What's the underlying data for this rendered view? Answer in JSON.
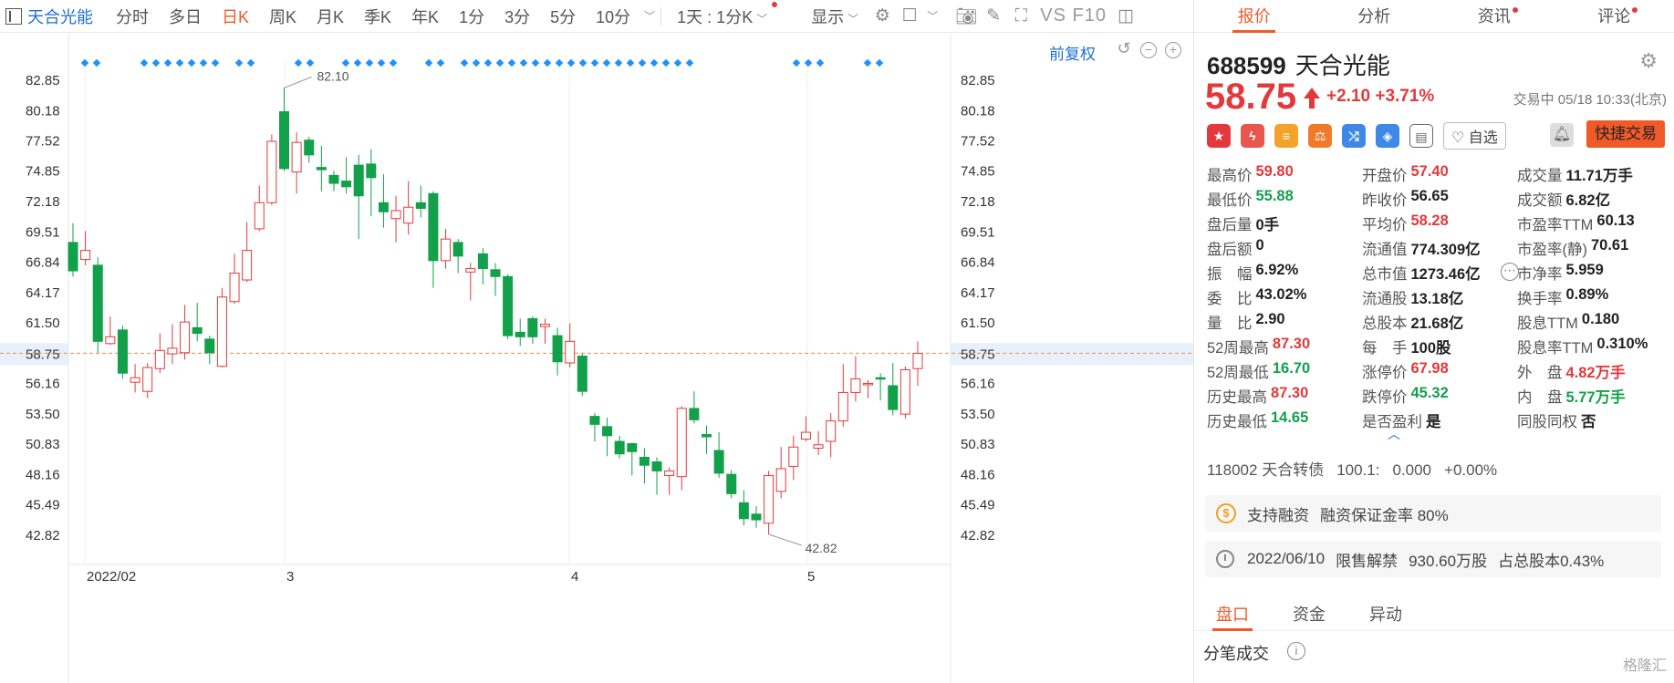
{
  "toolbar": {
    "stock_name": "天合光能",
    "periods": [
      "分时",
      "多日",
      "日K",
      "周K",
      "月K",
      "季K",
      "年K",
      "1分",
      "3分",
      "5分",
      "10分"
    ],
    "active_period": "日K",
    "kline_setting": "1天 : 1分K",
    "display": "显示",
    "vs_f10": "VS F10"
  },
  "chart": {
    "adjust_label": "前复权",
    "price_levels": [
      "82.85",
      "80.18",
      "77.52",
      "74.85",
      "72.18",
      "69.51",
      "66.84",
      "64.17",
      "61.50",
      "58.75",
      "56.16",
      "53.50",
      "50.83",
      "48.16",
      "45.49",
      "42.82"
    ],
    "x_labels": [
      "2022/02",
      "3",
      "4",
      "5"
    ],
    "high_note": "82.10",
    "low_note": "42.82",
    "current_price_label": "58.75"
  },
  "chart_data": {
    "type": "candlestick",
    "up_color": "#e4393c",
    "down_color": "#12a04a",
    "ylim": [
      41.5,
      84.5
    ],
    "current_price": 58.75,
    "candles": [
      [
        68.5,
        66.0,
        70.2,
        65.5
      ],
      [
        67.0,
        67.8,
        69.5,
        66.5
      ],
      [
        66.5,
        59.8,
        67.2,
        58.8
      ],
      [
        59.6,
        60.2,
        62.0,
        59.5
      ],
      [
        60.8,
        57.0,
        61.2,
        56.5
      ],
      [
        56.2,
        56.6,
        57.8,
        55.3
      ],
      [
        55.4,
        57.5,
        57.9,
        54.8
      ],
      [
        57.4,
        59.0,
        60.5,
        57.0
      ],
      [
        58.7,
        59.2,
        61.3,
        57.8
      ],
      [
        58.8,
        61.5,
        63.0,
        58.2
      ],
      [
        61.0,
        60.5,
        63.2,
        59.8
      ],
      [
        60.0,
        58.8,
        60.3,
        57.8
      ],
      [
        57.6,
        63.7,
        64.5,
        57.5
      ],
      [
        63.3,
        65.8,
        67.5,
        63.1
      ],
      [
        65.2,
        67.8,
        70.3,
        65.0
      ],
      [
        69.7,
        72.0,
        73.5,
        69.5
      ],
      [
        72.0,
        77.4,
        78.0,
        71.8
      ],
      [
        80.0,
        75.0,
        82.1,
        74.8
      ],
      [
        74.7,
        77.3,
        78.2,
        72.8
      ],
      [
        77.5,
        76.2,
        77.8,
        75.5
      ],
      [
        75.1,
        74.9,
        77.0,
        73.0
      ],
      [
        74.4,
        73.7,
        74.8,
        73.0
      ],
      [
        73.9,
        73.4,
        76.0,
        72.8
      ],
      [
        75.3,
        72.6,
        76.2,
        68.8
      ],
      [
        75.4,
        74.2,
        76.7,
        70.8
      ],
      [
        72.0,
        71.2,
        74.5,
        69.8
      ],
      [
        70.6,
        71.3,
        72.6,
        68.5
      ],
      [
        70.2,
        71.6,
        73.9,
        69.2
      ],
      [
        72.0,
        71.5,
        73.5,
        70.7
      ],
      [
        72.8,
        66.9,
        73.0,
        64.5
      ],
      [
        66.9,
        68.8,
        69.7,
        66.2
      ],
      [
        68.5,
        67.3,
        68.8,
        65.8
      ],
      [
        65.9,
        66.2,
        66.7,
        63.4
      ],
      [
        67.5,
        66.2,
        68.0,
        64.8
      ],
      [
        66.1,
        65.5,
        66.7,
        63.8
      ],
      [
        65.5,
        60.3,
        65.7,
        60.0
      ],
      [
        60.6,
        60.2,
        61.8,
        59.4
      ],
      [
        61.8,
        60.2,
        62.0,
        59.6
      ],
      [
        61.1,
        61.3,
        61.8,
        59.6
      ],
      [
        60.3,
        58.0,
        61.0,
        56.8
      ],
      [
        57.9,
        59.8,
        61.4,
        57.5
      ],
      [
        58.5,
        55.4,
        58.7,
        55.0
      ],
      [
        53.2,
        52.5,
        53.5,
        51.0
      ],
      [
        52.3,
        51.5,
        53.1,
        49.7
      ],
      [
        51.0,
        49.9,
        51.5,
        49.5
      ],
      [
        50.8,
        50.1,
        50.9,
        48.0
      ],
      [
        49.6,
        48.9,
        50.4,
        47.3
      ],
      [
        49.2,
        48.4,
        49.6,
        46.3
      ],
      [
        48.0,
        48.4,
        48.7,
        46.3
      ],
      [
        47.9,
        53.9,
        54.1,
        46.7
      ],
      [
        53.9,
        52.9,
        55.4,
        52.6
      ],
      [
        51.6,
        51.4,
        52.4,
        49.9
      ],
      [
        50.2,
        48.2,
        51.8,
        47.8
      ],
      [
        48.1,
        46.4,
        48.5,
        46.0
      ],
      [
        45.6,
        44.2,
        46.7,
        43.6
      ],
      [
        44.6,
        44.1,
        45.3,
        43.4
      ],
      [
        43.8,
        48.0,
        48.4,
        42.82
      ],
      [
        46.6,
        48.6,
        50.5,
        46.0
      ],
      [
        48.8,
        50.5,
        51.5,
        47.6
      ],
      [
        51.2,
        51.8,
        53.2,
        51.0
      ],
      [
        50.4,
        50.7,
        51.9,
        49.8
      ],
      [
        51.0,
        52.8,
        53.5,
        49.6
      ],
      [
        52.8,
        55.3,
        57.8,
        52.3
      ],
      [
        55.3,
        56.5,
        58.5,
        54.5
      ],
      [
        56.0,
        56.1,
        56.4,
        54.8
      ],
      [
        56.6,
        56.5,
        57.0,
        54.6
      ],
      [
        55.9,
        53.8,
        57.9,
        53.3
      ],
      [
        53.4,
        57.3,
        57.6,
        53.0
      ],
      [
        57.4,
        58.75,
        59.8,
        55.88
      ]
    ],
    "markers_x": [
      "first",
      "row"
    ]
  },
  "panel": {
    "tabs": [
      "报价",
      "分析",
      "资讯",
      "评论"
    ],
    "code": "688599",
    "name": "天合光能",
    "price": "58.75",
    "change": "+2.10 +3.71%",
    "status": "交易中 05/18 10:33(北京)",
    "zixuan": "自选",
    "quick_trade": "快捷交易",
    "quote": [
      [
        [
          "最高价",
          "59.80",
          "red"
        ],
        [
          "开盘价",
          "57.40",
          "red"
        ],
        [
          "成交量",
          "11.71万手",
          ""
        ]
      ],
      [
        [
          "最低价",
          "55.88",
          "green"
        ],
        [
          "昨收价",
          "56.65",
          ""
        ],
        [
          "成交额",
          "6.82亿",
          ""
        ]
      ],
      [
        [
          "盘后量",
          "0手",
          ""
        ],
        [
          "平均价",
          "58.28",
          "red"
        ],
        [
          "市盈率TTM",
          "60.13",
          ""
        ]
      ],
      [
        [
          "盘后额",
          "0",
          ""
        ],
        [
          "流通值",
          "774.309亿",
          ""
        ],
        [
          "市盈率(静)",
          "70.61",
          ""
        ]
      ],
      [
        [
          "振　幅",
          "6.92%",
          ""
        ],
        [
          "总市值",
          "1273.46亿",
          ""
        ],
        [
          "市净率",
          "5.959",
          ""
        ]
      ],
      [
        [
          "委　比",
          "43.02%",
          ""
        ],
        [
          "流通股",
          "13.18亿",
          ""
        ],
        [
          "换手率",
          "0.89%",
          ""
        ]
      ],
      [
        [
          "量　比",
          "2.90",
          ""
        ],
        [
          "总股本",
          "21.68亿",
          ""
        ],
        [
          "股息TTM",
          "0.180",
          ""
        ]
      ],
      [
        [
          "52周最高",
          "87.30",
          "red"
        ],
        [
          "每　手",
          "100股",
          ""
        ],
        [
          "股息率TTM",
          "0.310%",
          ""
        ]
      ],
      [
        [
          "52周最低",
          "16.70",
          "green"
        ],
        [
          "涨停价",
          "67.98",
          "red"
        ],
        [
          "外　盘",
          "4.82万手",
          "red"
        ]
      ],
      [
        [
          "历史最高",
          "87.30",
          "red"
        ],
        [
          "跌停价",
          "45.32",
          "green"
        ],
        [
          "内　盘",
          "5.77万手",
          "green"
        ]
      ],
      [
        [
          "历史最低",
          "14.65",
          "green"
        ],
        [
          "是否盈利",
          "是",
          ""
        ],
        [
          "同股同权",
          "否",
          ""
        ]
      ]
    ],
    "bond": [
      "118002 天合转债",
      "100.1:",
      "0.000",
      "+0.00%"
    ],
    "margin": [
      "支持融资",
      "融资保证金率 80%"
    ],
    "unlock": [
      "2022/06/10",
      "限售解禁",
      "930.60万股",
      "占总股本0.43%"
    ],
    "bottom_tabs": [
      "盘口",
      "资金",
      "异动"
    ],
    "trades_title": "分笔成交",
    "watermark": "格隆汇"
  }
}
